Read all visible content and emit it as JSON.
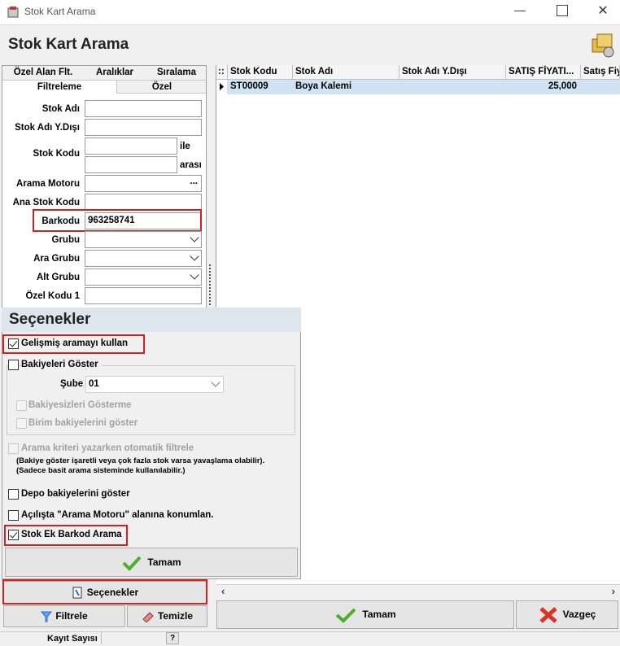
{
  "window": {
    "title": "Stok Kart Arama"
  },
  "header": {
    "title": "Stok Kart Arama"
  },
  "tabs": {
    "row1": [
      "Özel Alan Flt.",
      "Aralıklar",
      "Sıralama"
    ],
    "row2": [
      "Filtreleme",
      "Özel"
    ]
  },
  "filter": {
    "stok_adi": "Stok Adı",
    "stok_adi_ydisi": "Stok Adı Y.Dışı",
    "stok_kodu": "Stok Kodu",
    "ile": "ile",
    "arasi": "arası",
    "arama_motoru": "Arama Motoru",
    "ana_stok_kodu": "Ana Stok Kodu",
    "barkodu": "Barkodu",
    "barkodu_value": "963258741",
    "grubu": "Grubu",
    "ara_grubu": "Ara Grubu",
    "alt_grubu": "Alt Grubu",
    "ozel_kodu_1": "Özel Kodu 1",
    "ellipsis": "..."
  },
  "grid": {
    "indicator": "::",
    "columns": [
      "Stok Kodu",
      "Stok Adı",
      "Stok Adı Y.Dışı",
      "SATIŞ FİYATI...",
      "Satış Fiy"
    ],
    "rows": [
      {
        "stok_kodu": "ST00009",
        "stok_adi": "Boya Kalemi",
        "stok_adi_ydisi": "",
        "satis_fiyati": "25,000",
        "satis_fiy": ""
      }
    ]
  },
  "options": {
    "title": "Seçenekler",
    "gelismis": "Gelişmiş aramayı kullan",
    "bakiyeleri_goster": "Bakiyeleri Göster",
    "sube_label": "Şube",
    "sube_value": "01",
    "bakiyesizleri": "Bakiyesizleri Gösterme",
    "birim_bakiye": "Birim bakiyelerini göster",
    "otomatik_filtre": "Arama kriteri yazarken otomatik filtrele",
    "note_line1": "(Bakiye göster işaretli veya çok fazla stok varsa yavaşlama olabilir).",
    "note_line2": "(Sadece basit arama sisteminde kullanılabilir.)",
    "depo_bakiye": "Depo bakiyelerini göster",
    "acilista": "Açılışta \"Arama Motoru\" alanına konumlan.",
    "stok_ek_barkod": "Stok Ek Barkod Arama",
    "tamam": "Tamam"
  },
  "buttons": {
    "secenekler": "Seçenekler",
    "filtrele": "Filtrele",
    "temizle": "Temizle",
    "tamam": "Tamam",
    "vazgec": "Vazgeç"
  },
  "status": {
    "kayit_sayisi": "Kayıt Sayısı",
    "help": "?"
  },
  "colors": {
    "highlight": "#d61f1f",
    "selected_row": "#cfe3f5",
    "options_header": "#dde6ef"
  }
}
